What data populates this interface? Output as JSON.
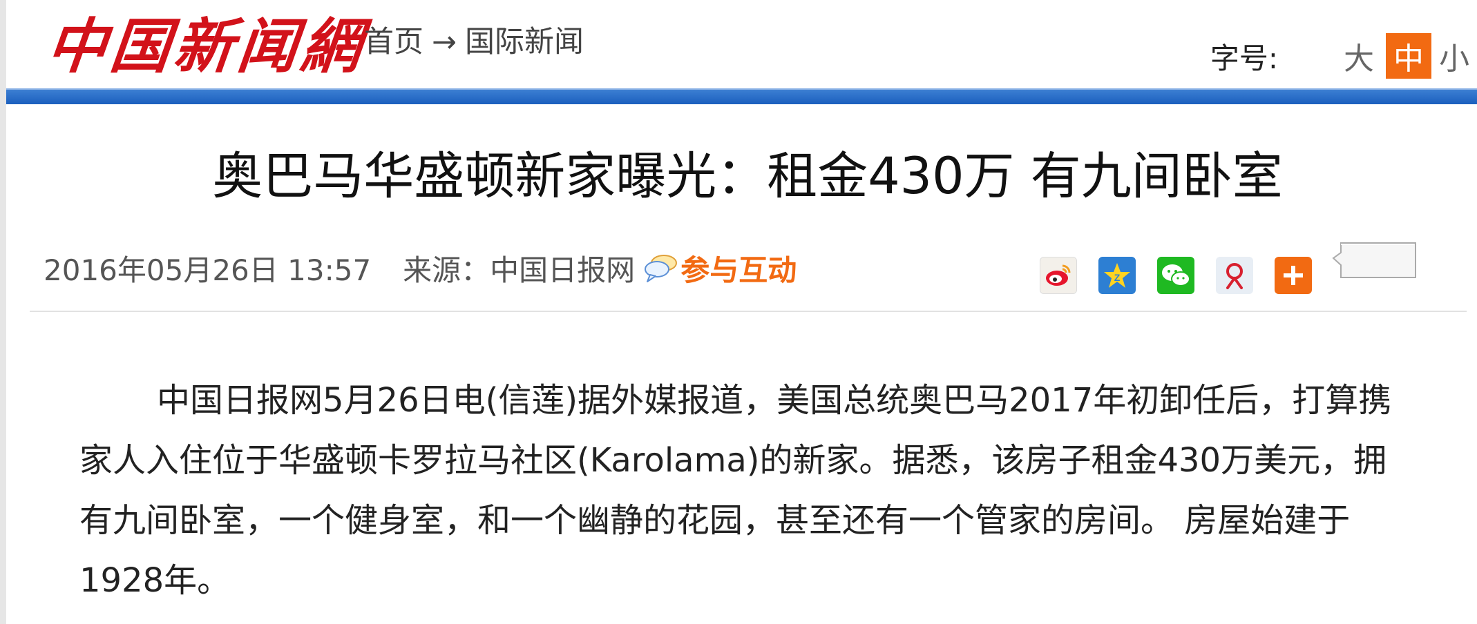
{
  "header": {
    "logo_text": "中国新闻網",
    "breadcrumb": {
      "home": "首页",
      "arrow": "→",
      "section": "国际新闻"
    },
    "font_size": {
      "label": "字号:",
      "options": [
        "大",
        "中",
        "小"
      ],
      "selected": "中"
    }
  },
  "article": {
    "title": "奥巴马华盛顿新家曝光：租金430万 有九间卧室",
    "datetime": "2016年05月26日 13:57",
    "source": "来源：中国日报网",
    "interact_label": "参与互动",
    "share_icons": [
      "weibo-icon",
      "qzone-icon",
      "wechat-icon",
      "renren-icon",
      "more-plus-icon"
    ],
    "body": "中国日报网5月26日电(信莲)据外媒报道，美国总统奥巴马2017年初卸任后，打算携家人入住位于华盛顿卡罗拉马社区(Karolama)的新家。据悉，该房子租金430万美元，拥有九间卧室，一个健身室，和一个幽静的花园，甚至还有一个管家的房间。 房屋始建于1928年。"
  },
  "colors": {
    "brand_red": "#d2121a",
    "accent_orange": "#f26a12",
    "bar_blue": "#1b5fbe"
  }
}
